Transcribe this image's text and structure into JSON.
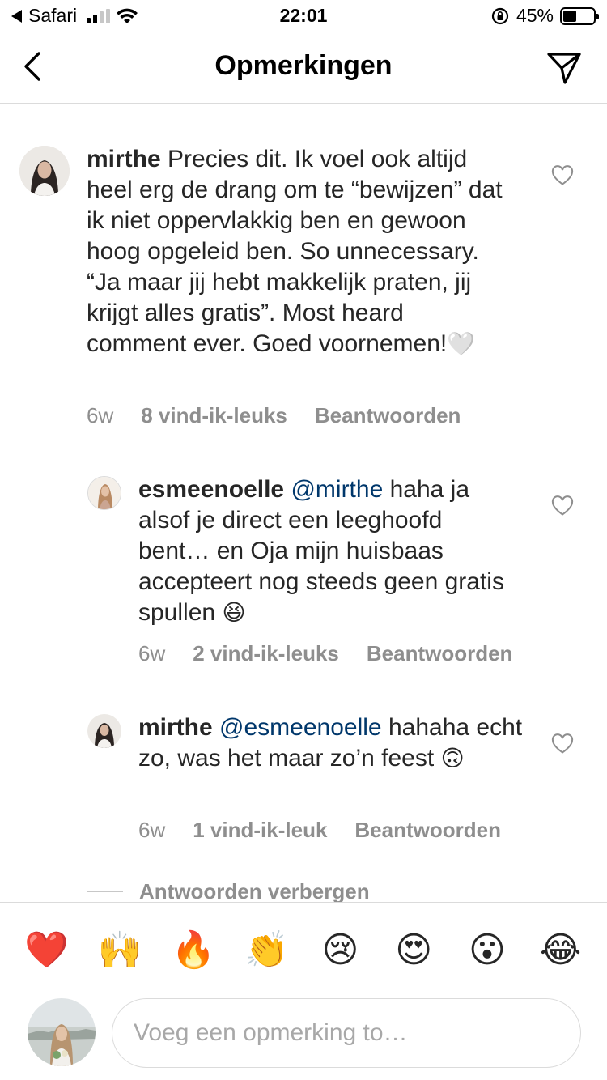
{
  "status_bar": {
    "carrier": "Safari",
    "time": "22:01",
    "battery": "45%",
    "battery_level": 0.45
  },
  "header": {
    "title": "Opmerkingen",
    "back_icon": "chevron-left-icon",
    "send_icon": "paper-plane-icon"
  },
  "comments": [
    {
      "username": "mirthe",
      "mention": "",
      "text": "Precies dit. Ik voel ook altijd heel erg de drang om te “bewijzen” dat ik niet oppervlakkig ben en gewoon hoog opgeleid ben. So unnecessary. “Ja maar jij hebt makkelijk praten, jij krijgt alles gratis”. Most heard comment ever. Goed voornemen!",
      "emoji": "🤍",
      "age": "6w",
      "likes": "8 vind-ik-leuks",
      "reply": "Beantwoorden"
    },
    {
      "username": "esmeenoelle",
      "mention": "@mirthe",
      "text": "haha ja alsof je direct een leeghoofd bent… en Oja mijn huisbaas accepteert nog steeds geen gratis spullen",
      "emoji": "😆",
      "age": "6w",
      "likes": "2 vind-ik-leuks",
      "reply": "Beantwoorden"
    },
    {
      "username": "mirthe",
      "mention": "@esmeenoelle",
      "text": "hahaha echt zo, was het maar zo’n feest",
      "emoji": "🙃",
      "age": "6w",
      "likes": "1 vind-ik-leuk",
      "reply": "Beantwoorden"
    }
  ],
  "hide_replies": "Antwoorden verbergen",
  "quick_emojis": [
    "❤️",
    "🙌",
    "🔥",
    "👏",
    "😢",
    "😍",
    "😮",
    "😂"
  ],
  "composer": {
    "placeholder": "Voeg een opmerking to…"
  }
}
